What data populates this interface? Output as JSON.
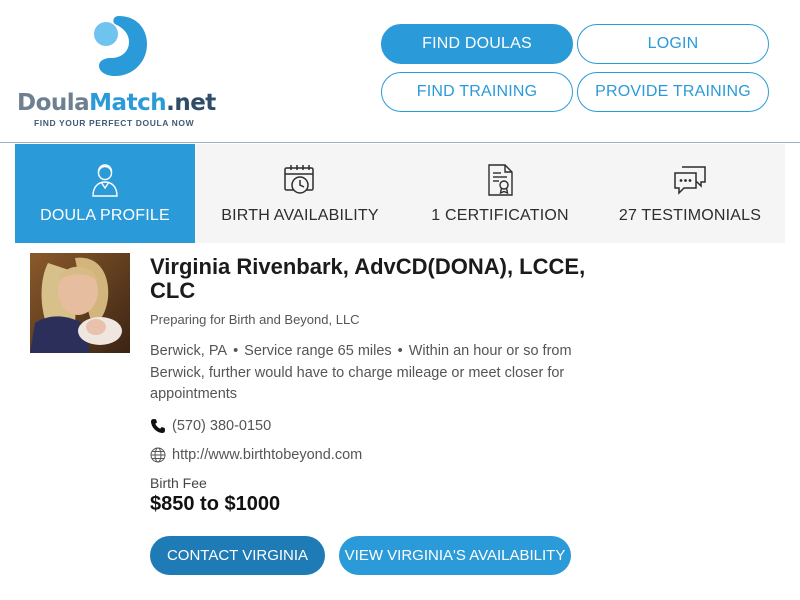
{
  "logo": {
    "part1": "Doula",
    "part2": "Match",
    "part3": ".net",
    "tagline": "FIND YOUR PERFECT DOULA NOW"
  },
  "nav": {
    "find_doulas": "FIND DOULAS",
    "login": "LOGIN",
    "find_training": "FIND TRAINING",
    "provide_training": "PROVIDE TRAINING"
  },
  "tabs": [
    {
      "label": "DOULA PROFILE",
      "icon": "doula-profile-icon",
      "active": true
    },
    {
      "label": "BIRTH AVAILABILITY",
      "icon": "calendar-clock-icon",
      "active": false
    },
    {
      "label": "1 CERTIFICATION",
      "icon": "certificate-icon",
      "active": false
    },
    {
      "label": "27 TESTIMONIALS",
      "icon": "chat-bubbles-icon",
      "active": false
    }
  ],
  "profile": {
    "name": "Virginia Rivenbark, AdvCD(DONA), LCCE, CLC",
    "business": "Preparing for Birth and Beyond, LLC",
    "city": "Berwick, PA",
    "service_range": "Service range 65 miles",
    "travel_note": "Within an hour or so from Berwick, further would have to charge mileage or meet closer for appointments",
    "phone": "(570) 380-0150",
    "website": "http://www.birthtobeyond.com",
    "fee_label": "Birth Fee",
    "fee_value": "$850 to $1000"
  },
  "actions": {
    "contact": "CONTACT VIRGINIA",
    "availability": "VIEW VIRGINIA'S AVAILABILITY"
  },
  "colors": {
    "brand_blue": "#2a9ad8",
    "dark_blue": "#1f7bb5",
    "navy": "#2f4d69",
    "tab_bg": "#f5f5f5"
  }
}
